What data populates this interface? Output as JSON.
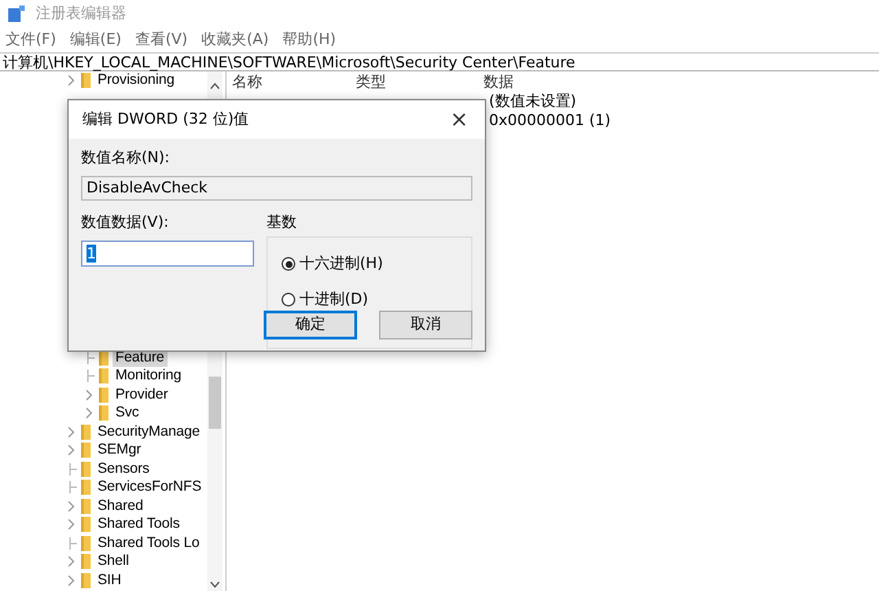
{
  "window": {
    "title": "注册表编辑器"
  },
  "menu": [
    "文件(F)",
    "编辑(E)",
    "查看(V)",
    "收藏夹(A)",
    "帮助(H)"
  ],
  "address": "计算机\\HKEY_LOCAL_MACHINE\\SOFTWARE\\Microsoft\\Security Center\\Feature",
  "tree": [
    {
      "label": "Provisioning",
      "expandable": true,
      "selected": false
    },
    {
      "children": [
        {
          "label": "Feature",
          "expandable": false,
          "selected": true
        },
        {
          "label": "Monitoring",
          "expandable": false,
          "selected": false
        },
        {
          "label": "Provider",
          "expandable": true,
          "selected": false
        },
        {
          "label": "Svc",
          "expandable": true,
          "selected": false
        }
      ]
    },
    {
      "label": "SecurityManage",
      "expandable": true,
      "selected": false
    },
    {
      "label": "SEMgr",
      "expandable": true,
      "selected": false
    },
    {
      "label": "Sensors",
      "expandable": false,
      "selected": false
    },
    {
      "label": "ServicesForNFS",
      "expandable": false,
      "selected": false
    },
    {
      "label": "Shared",
      "expandable": true,
      "selected": false
    },
    {
      "label": "Shared Tools",
      "expandable": true,
      "selected": false
    },
    {
      "label": "Shared Tools Lo",
      "expandable": false,
      "selected": false
    },
    {
      "label": "Shell",
      "expandable": true,
      "selected": false
    },
    {
      "label": "SIH",
      "expandable": true,
      "selected": false
    }
  ],
  "values": {
    "columns": [
      "名称",
      "类型",
      "数据"
    ],
    "rows": [
      {
        "data": "(数值未设置)"
      },
      {
        "data": "0x00000001 (1)"
      }
    ]
  },
  "dialog": {
    "title": "编辑 DWORD (32 位)值",
    "close": "×",
    "name_label": "数值名称(N):",
    "name_value": "DisableAvCheck",
    "data_label": "数值数据(V):",
    "data_value": "1",
    "base_label": "基数",
    "bases": [
      {
        "label": "十六进制(H)",
        "selected": true
      },
      {
        "label": "十进制(D)",
        "selected": false
      }
    ],
    "buttons": [
      {
        "label": "确定",
        "default": true
      },
      {
        "label": "取消",
        "default": false
      }
    ]
  }
}
